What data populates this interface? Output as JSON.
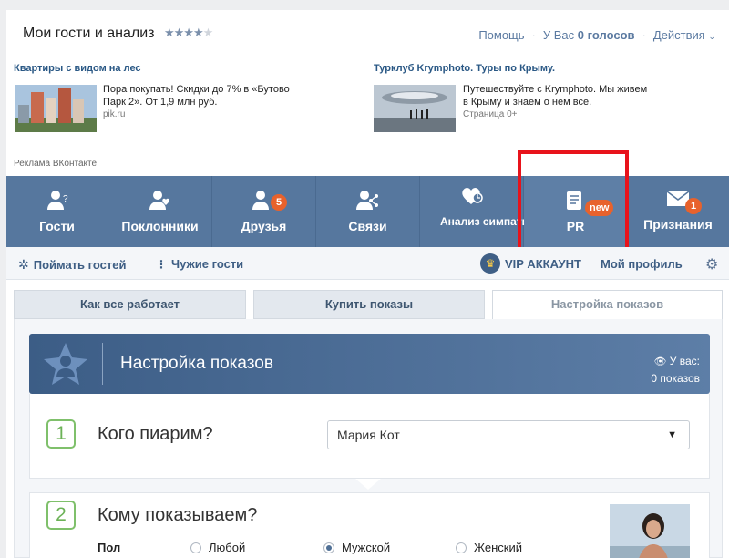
{
  "header": {
    "title": "Мои гости и анализ",
    "rating": {
      "value": 4,
      "max": 5
    },
    "help": "Помощь",
    "votes_prefix": "У Вас",
    "votes_value": "0 голосов",
    "actions": "Действия"
  },
  "ads": [
    {
      "title": "Квартиры с видом на лес",
      "text": "Пора покупать! Скидки до 7% в «Бутово Парк 2». От 1,9 млн руб.",
      "domain": "pik.ru"
    },
    {
      "title": "Турклуб Krymphoto. Туры по Крыму.",
      "text": "Путешествуйте с Krymphoto. Мы живем в Крыму и знаем о нем все.",
      "domain": "Страница 0+"
    }
  ],
  "ad_label": "Реклама ВКонтакте",
  "tabs": [
    {
      "label": "Гости",
      "icon": "guest-icon"
    },
    {
      "label": "Поклонники",
      "icon": "fan-icon"
    },
    {
      "label": "Друзья",
      "icon": "friends-icon",
      "badge": "5"
    },
    {
      "label": "Связи",
      "icon": "connections-icon"
    },
    {
      "label": "Анализ симпатий",
      "icon": "sympathy-icon"
    },
    {
      "label": "PR",
      "icon": "pr-icon",
      "badge": "new"
    },
    {
      "label": "Признания",
      "icon": "envelope-icon",
      "badge": "1"
    }
  ],
  "subnav": {
    "catch_guests": "Поймать гостей",
    "foreign_guests": "Чужие гости",
    "vip": "VIP АККАУНТ",
    "profile": "Мой профиль"
  },
  "content_tabs": [
    "Как все работает",
    "Купить показы",
    "Настройка показов"
  ],
  "banner": {
    "title": "Настройка показов",
    "votes_label": "У вас:",
    "votes_value": "0 показов"
  },
  "step1": {
    "number": "1",
    "question": "Кого пиарим?",
    "selected": "Мария Кот"
  },
  "step2": {
    "number": "2",
    "question": "Кому показываем?",
    "gender_label": "Пол",
    "options": [
      "Любой",
      "Мужской",
      "Женский"
    ],
    "selected_index": 1
  },
  "colors": {
    "accent": "#56779e",
    "badge": "#e8622c",
    "highlight": "#e8131b",
    "step": "#6cb257"
  }
}
